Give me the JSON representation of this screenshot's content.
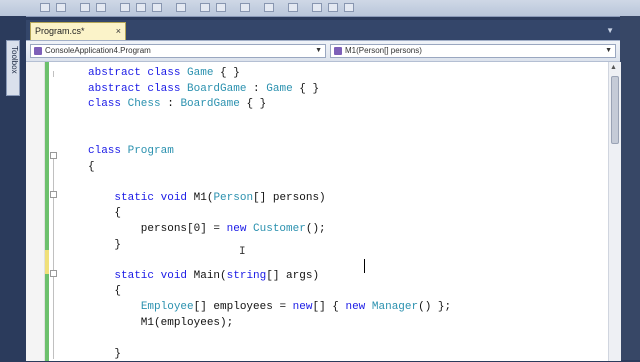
{
  "tab": {
    "title": "Program.cs*",
    "close": "×"
  },
  "nav": {
    "type_combo": "ConsoleApplication4.Program",
    "member_combo": "M1(Person[] persons)"
  },
  "toolbox": {
    "label": "Toolbox"
  },
  "code_lines": [
    [
      {
        "t": "abstract class ",
        "c": "kw"
      },
      {
        "t": "Game",
        "c": "ty"
      },
      {
        "t": " { }",
        "c": ""
      }
    ],
    [
      {
        "t": "abstract class ",
        "c": "kw"
      },
      {
        "t": "BoardGame",
        "c": "ty"
      },
      {
        "t": " : ",
        "c": ""
      },
      {
        "t": "Game",
        "c": "ty"
      },
      {
        "t": " { }",
        "c": ""
      }
    ],
    [
      {
        "t": "class ",
        "c": "kw"
      },
      {
        "t": "Chess",
        "c": "ty"
      },
      {
        "t": " : ",
        "c": ""
      },
      {
        "t": "BoardGame",
        "c": "ty"
      },
      {
        "t": " { }",
        "c": ""
      }
    ],
    [],
    [],
    [
      {
        "t": "class ",
        "c": "kw"
      },
      {
        "t": "Program",
        "c": "ty"
      }
    ],
    [
      {
        "t": "{",
        "c": ""
      }
    ],
    [],
    [
      {
        "t": "    static void ",
        "c": "kw"
      },
      {
        "t": "M1(",
        "c": ""
      },
      {
        "t": "Person",
        "c": "ty"
      },
      {
        "t": "[] persons)",
        "c": ""
      }
    ],
    [
      {
        "t": "    {",
        "c": ""
      }
    ],
    [
      {
        "t": "        persons[0] = ",
        "c": ""
      },
      {
        "t": "new ",
        "c": "kw"
      },
      {
        "t": "Customer",
        "c": "ty"
      },
      {
        "t": "();",
        "c": ""
      }
    ],
    [
      {
        "t": "    }",
        "c": ""
      }
    ],
    [],
    [
      {
        "t": "    static void ",
        "c": "kw"
      },
      {
        "t": "Main(",
        "c": ""
      },
      {
        "t": "string",
        "c": "kw"
      },
      {
        "t": "[] args)",
        "c": ""
      }
    ],
    [
      {
        "t": "    {",
        "c": ""
      }
    ],
    [
      {
        "t": "        ",
        "c": ""
      },
      {
        "t": "Employee",
        "c": "ty"
      },
      {
        "t": "[] employees = ",
        "c": ""
      },
      {
        "t": "new",
        "c": "kw"
      },
      {
        "t": "[] { ",
        "c": ""
      },
      {
        "t": "new ",
        "c": "kw"
      },
      {
        "t": "Manager",
        "c": "ty"
      },
      {
        "t": "() };",
        "c": ""
      }
    ],
    [
      {
        "t": "        M1(employees);",
        "c": ""
      }
    ],
    [],
    [
      {
        "t": "    }",
        "c": ""
      }
    ]
  ],
  "colors": {
    "keyword": "#1a1ae6",
    "type": "#2b91af",
    "tab_active": "#fbf3c9",
    "change_bar": "#6cc06c"
  }
}
